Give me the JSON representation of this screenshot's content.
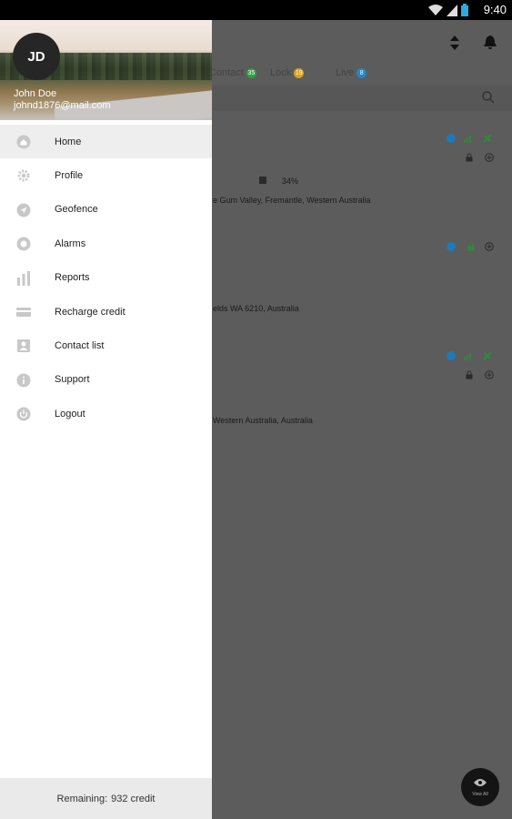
{
  "status_bar": {
    "time": "9:40"
  },
  "background": {
    "tabs": [
      {
        "label": "Contact",
        "badge": "35",
        "badge_color": "#2ea043"
      },
      {
        "label": "Lock",
        "badge": "19",
        "badge_color": "#d9a21b"
      },
      {
        "label": "Live",
        "badge": "8",
        "badge_color": "#1e88c8"
      }
    ],
    "cards": [
      {
        "percent": "34%",
        "address": "e Gum Valley, Fremantle, Western Australia"
      },
      {
        "address": "elds WA 6210, Australia"
      },
      {
        "address": "Western Australia, Australia"
      }
    ],
    "fab_label": "View All"
  },
  "drawer": {
    "avatar_initials": "JD",
    "user_name": "John Doe",
    "user_email": "johnd1876@mail.com",
    "menu": [
      {
        "label": "Home",
        "icon": "home-icon"
      },
      {
        "label": "Profile",
        "icon": "gear-icon"
      },
      {
        "label": "Geofence",
        "icon": "navigation-icon"
      },
      {
        "label": "Alarms",
        "icon": "alarm-icon"
      },
      {
        "label": "Reports",
        "icon": "bar-chart-icon"
      },
      {
        "label": "Recharge credit",
        "icon": "credit-card-icon"
      },
      {
        "label": "Contact list",
        "icon": "contact-list-icon"
      },
      {
        "label": "Support",
        "icon": "info-icon"
      },
      {
        "label": "Logout",
        "icon": "power-icon"
      }
    ],
    "footer": {
      "label": "Remaining:",
      "value": "932 credit"
    }
  }
}
